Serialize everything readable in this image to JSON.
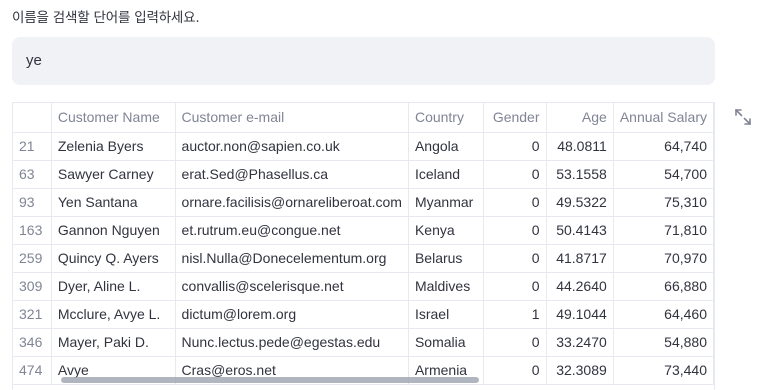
{
  "prompt": "이름을 검색할 단어를 입력하세요.",
  "search": {
    "value": "ye"
  },
  "table": {
    "columns": [
      "",
      "Customer Name",
      "Customer e-mail",
      "Country",
      "Gender",
      "Age",
      "Annual Salary"
    ],
    "rows": [
      {
        "index": "21",
        "name": "Zelenia Byers",
        "email": "auctor.non@sapien.co.uk",
        "country": "Angola",
        "gender": "0",
        "age": "48.0811",
        "annual": "64,740"
      },
      {
        "index": "63",
        "name": "Sawyer Carney",
        "email": "erat.Sed@Phasellus.ca",
        "country": "Iceland",
        "gender": "0",
        "age": "53.1558",
        "annual": "54,700"
      },
      {
        "index": "93",
        "name": "Yen Santana",
        "email": "ornare.facilisis@ornareliberoat.com",
        "country": "Myanmar",
        "gender": "0",
        "age": "49.5322",
        "annual": "75,310"
      },
      {
        "index": "163",
        "name": "Gannon Nguyen",
        "email": "et.rutrum.eu@congue.net",
        "country": "Kenya",
        "gender": "0",
        "age": "50.4143",
        "annual": "71,810"
      },
      {
        "index": "259",
        "name": "Quincy Q. Ayers",
        "email": "nisl.Nulla@Donecelementum.org",
        "country": "Belarus",
        "gender": "0",
        "age": "41.8717",
        "annual": "70,970"
      },
      {
        "index": "309",
        "name": "Dyer, Aline L.",
        "email": "convallis@scelerisque.net",
        "country": "Maldives",
        "gender": "0",
        "age": "44.2640",
        "annual": "66,880"
      },
      {
        "index": "321",
        "name": "Mcclure, Avye L.",
        "email": "dictum@lorem.org",
        "country": "Israel",
        "gender": "1",
        "age": "49.1044",
        "annual": "64,460"
      },
      {
        "index": "346",
        "name": "Mayer, Paki D.",
        "email": "Nunc.lectus.pede@egestas.edu",
        "country": "Somalia",
        "gender": "0",
        "age": "33.2470",
        "annual": "54,880"
      },
      {
        "index": "474",
        "name": "Avye",
        "email": "Cras@eros.net",
        "country": "Armenia",
        "gender": "0",
        "age": "32.3089",
        "annual": "73,440"
      }
    ]
  }
}
